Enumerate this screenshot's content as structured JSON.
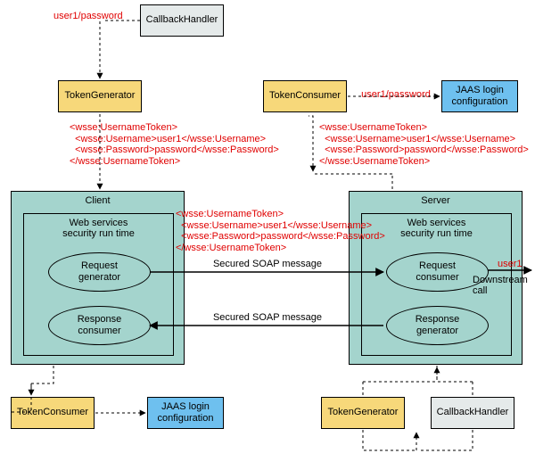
{
  "top": {
    "credentials": "user1/password",
    "callback_handler": "CallbackHandler",
    "token_generator": "TokenGenerator",
    "token_consumer": "TokenConsumer",
    "credentials_right": "user1/password",
    "jaas": "JAAS login\nconfiguration",
    "xml_left": "<wsse:UsernameToken>\n  <wsse:Username>user1</wsse:Username>\n  <wsse:Password>password</wsse:Password>\n</wsse:UsernameToken>",
    "xml_right": "<wsse:UsernameToken>\n  <wsse:Username>user1</wsse:Username>\n  <wsse:Password>password</wsse:Password>\n</wsse:UsernameToken>"
  },
  "client": {
    "title": "Client",
    "runtime": "Web services\nsecurity run time",
    "req_gen": "Request\ngenerator",
    "resp_cons": "Response\nconsumer"
  },
  "server": {
    "title": "Server",
    "runtime": "Web services\nsecurity run time",
    "req_cons": "Request\nconsumer",
    "resp_gen": "Response\ngenerator"
  },
  "middle": {
    "xml": "<wsse:UsernameToken>\n  <wsse:Username>user1</wsse:Username>\n  <wsse:Password>password</wsse:Password>\n</wsse:UsernameToken>",
    "soap1": "Secured SOAP message",
    "soap2": "Secured SOAP message",
    "user1": "user1",
    "downstream": "Downstream\ncall"
  },
  "bottom": {
    "token_consumer": "TokenConsumer",
    "jaas_left": "JAAS login\nconfiguration",
    "token_generator": "TokenGenerator",
    "callback_handler": "CallbackHandler"
  }
}
